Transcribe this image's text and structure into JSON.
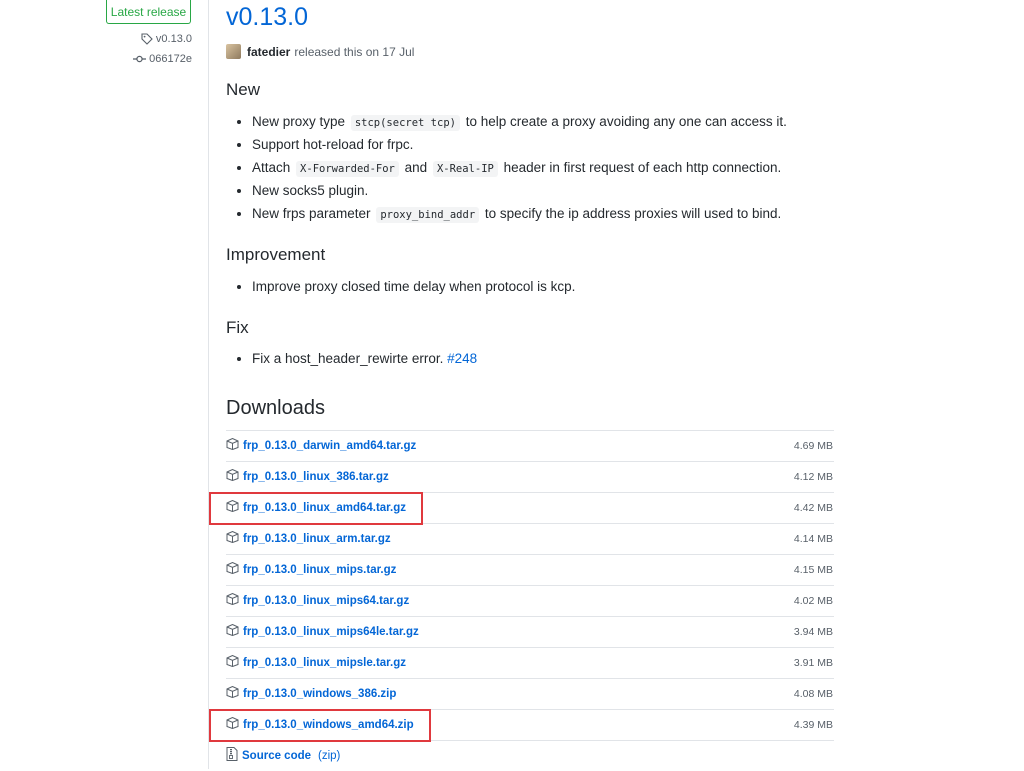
{
  "sidebar": {
    "badge": "Latest release",
    "tag": "v0.13.0",
    "commit": "066172e"
  },
  "release": {
    "title": "v0.13.0",
    "author": "fatedier",
    "released_text": "released this on 17 Jul"
  },
  "sections": {
    "new_title": "New",
    "new_items": [
      {
        "pre": "New proxy type",
        "code": "stcp(secret tcp)",
        "post": "to help create a proxy avoiding any one can access it."
      },
      {
        "text": "Support hot-reload for frpc."
      },
      {
        "pre": "Attach",
        "code1": "X-Forwarded-For",
        "mid": "and",
        "code2": "X-Real-IP",
        "post": "header in first request of each http connection."
      },
      {
        "text": "New socks5 plugin."
      },
      {
        "pre": "New frps parameter",
        "code": "proxy_bind_addr",
        "post": "to specify the ip address proxies will used to bind."
      }
    ],
    "improvement_title": "Improvement",
    "improvement_items": [
      {
        "text": "Improve proxy closed time delay when protocol is kcp."
      }
    ],
    "fix_title": "Fix",
    "fix_items": [
      {
        "pre": "Fix a host_header_rewirte error.",
        "link": "#248"
      }
    ]
  },
  "downloads": {
    "title": "Downloads",
    "assets": [
      {
        "name": "frp_0.13.0_darwin_amd64.tar.gz",
        "size": "4.69 MB",
        "highlighted": false
      },
      {
        "name": "frp_0.13.0_linux_386.tar.gz",
        "size": "4.12 MB",
        "highlighted": false
      },
      {
        "name": "frp_0.13.0_linux_amd64.tar.gz",
        "size": "4.42 MB",
        "highlighted": true
      },
      {
        "name": "frp_0.13.0_linux_arm.tar.gz",
        "size": "4.14 MB",
        "highlighted": false
      },
      {
        "name": "frp_0.13.0_linux_mips.tar.gz",
        "size": "4.15 MB",
        "highlighted": false
      },
      {
        "name": "frp_0.13.0_linux_mips64.tar.gz",
        "size": "4.02 MB",
        "highlighted": false
      },
      {
        "name": "frp_0.13.0_linux_mips64le.tar.gz",
        "size": "3.94 MB",
        "highlighted": false
      },
      {
        "name": "frp_0.13.0_linux_mipsle.tar.gz",
        "size": "3.91 MB",
        "highlighted": false
      },
      {
        "name": "frp_0.13.0_windows_386.zip",
        "size": "4.08 MB",
        "highlighted": false
      },
      {
        "name": "frp_0.13.0_windows_amd64.zip",
        "size": "4.39 MB",
        "highlighted": true
      }
    ],
    "source_label": "Source code",
    "source_format": "(zip)"
  },
  "colors": {
    "link": "#0366d6",
    "latest_green": "#28a745",
    "highlight_red": "#e0393e"
  }
}
